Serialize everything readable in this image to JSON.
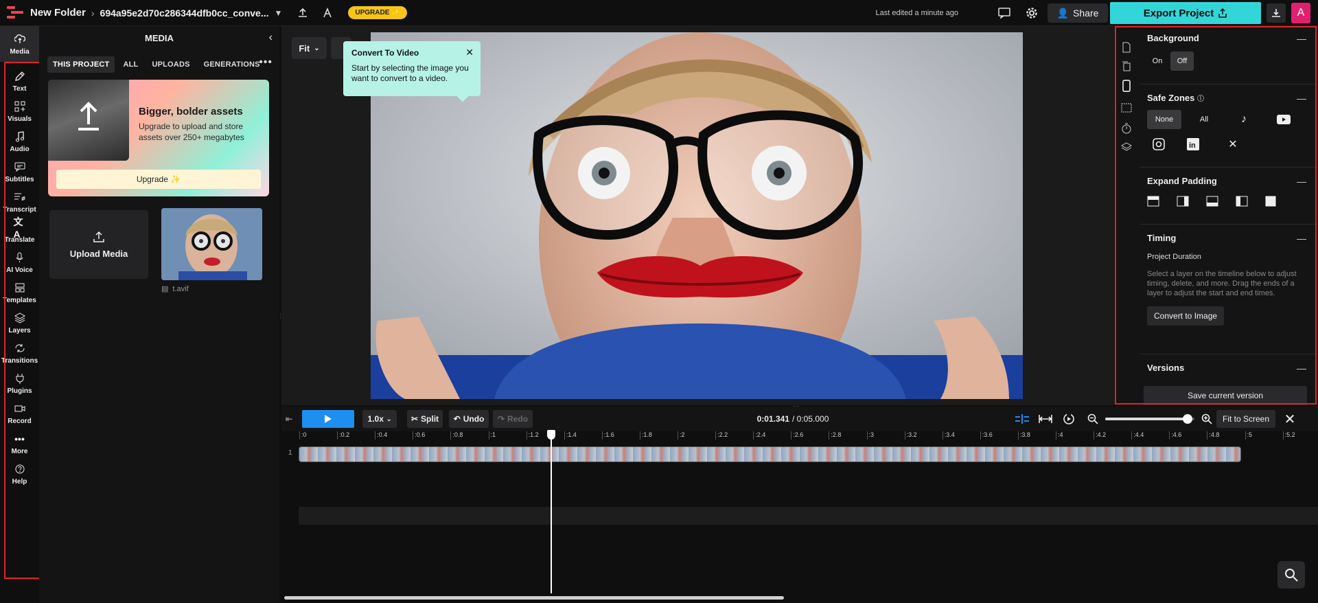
{
  "topbar": {
    "folder": "New Folder",
    "file_name": "694a95e2d70c286344dfb0cc_conve...",
    "upgrade_label": "UPGRADE ✨",
    "last_edited": "Last edited a minute ago",
    "share_label": "Share",
    "export_label": "Export Project",
    "avatar_initial": "A"
  },
  "leftnav": {
    "items": [
      {
        "label": "Media",
        "icon": "media-icon"
      },
      {
        "label": "Text",
        "icon": "text-icon"
      },
      {
        "label": "Visuals",
        "icon": "visuals-icon"
      },
      {
        "label": "Audio",
        "icon": "audio-icon"
      },
      {
        "label": "Subtitles",
        "icon": "subtitles-icon"
      },
      {
        "label": "Transcript",
        "icon": "transcript-icon"
      },
      {
        "label": "Translate",
        "icon": "translate-icon"
      },
      {
        "label": "AI Voice",
        "icon": "ai-voice-icon"
      },
      {
        "label": "Templates",
        "icon": "templates-icon"
      },
      {
        "label": "Layers",
        "icon": "layers-icon"
      },
      {
        "label": "Transitions",
        "icon": "transitions-icon"
      },
      {
        "label": "Plugins",
        "icon": "plugins-icon"
      },
      {
        "label": "Record",
        "icon": "record-icon"
      },
      {
        "label": "More",
        "icon": "more-icon"
      },
      {
        "label": "Help",
        "icon": "help-icon"
      }
    ]
  },
  "media": {
    "title": "MEDIA",
    "tabs": [
      "THIS PROJECT",
      "ALL",
      "UPLOADS",
      "GENERATIONS"
    ],
    "promo": {
      "title": "Bigger, bolder assets",
      "subtitle": "Upgrade to upload and store assets over 250+ megabytes",
      "button": "Upgrade ✨"
    },
    "upload_label": "Upload Media",
    "file_name": "t.avif"
  },
  "stage": {
    "fit_label": "Fit",
    "tooltip": {
      "title": "Convert To Video",
      "body": "Start by selecting the image you want to convert to a video."
    }
  },
  "props": {
    "background": {
      "title": "Background",
      "on": "On",
      "off": "Off"
    },
    "safe_zones": {
      "title": "Safe Zones",
      "none": "None",
      "all": "All"
    },
    "expand_padding": {
      "title": "Expand Padding"
    },
    "timing": {
      "title": "Timing",
      "subtitle": "Project Duration",
      "help": "Select a layer on the timeline below to adjust timing, delete, and more. Drag the ends of a layer to adjust the start and end times.",
      "convert_label": "Convert to Image"
    },
    "versions": {
      "title": "Versions",
      "save_label": "Save current version"
    }
  },
  "timeline": {
    "speed": "1.0x",
    "split": "Split",
    "undo": "Undo",
    "redo": "Redo",
    "current_time": "0:01.341",
    "total_time": "/ 0:05.000",
    "fit_to_screen": "Fit to Screen",
    "track_number": "1",
    "zoom_level": 0.92,
    "ticks": [
      ":0",
      ":0.2",
      ":0.4",
      ":0.6",
      ":0.8",
      ":1",
      ":1.2",
      ":1.4",
      ":1.6",
      ":1.8",
      ":2",
      ":2.2",
      ":2.4",
      ":2.6",
      ":2.8",
      ":3",
      ":3.2",
      ":3.4",
      ":3.6",
      ":3.8",
      ":4",
      ":4.2",
      ":4.4",
      ":4.6",
      ":4.8",
      ":5",
      ":5.2"
    ]
  },
  "colors": {
    "accent": "#33d6d8",
    "play": "#1f8ef1",
    "highlight": "#e02424"
  }
}
